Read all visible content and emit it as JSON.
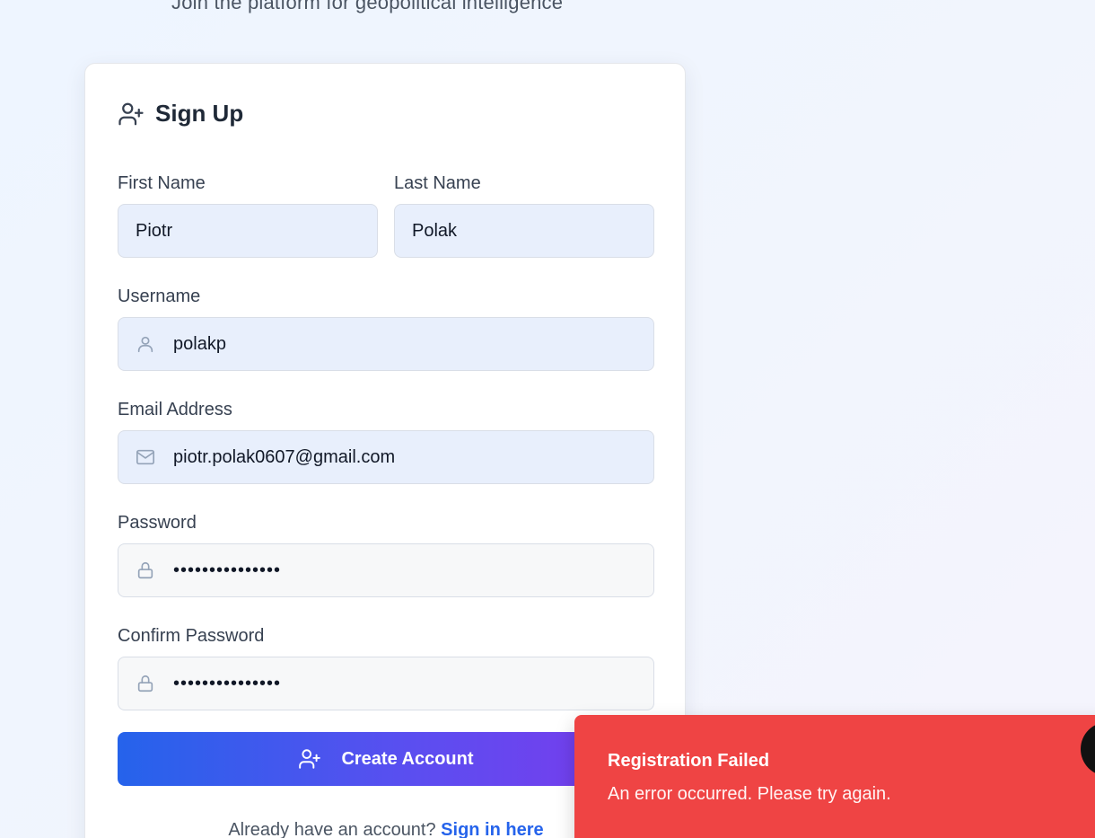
{
  "page": {
    "subtitle": "Join the platform for geopolitical intelligence"
  },
  "signup_card": {
    "icon": "user-plus-icon",
    "title": "Sign Up",
    "first_name": {
      "label": "First Name",
      "value": "Piotr"
    },
    "last_name": {
      "label": "Last Name",
      "value": "Polak"
    },
    "username": {
      "label": "Username",
      "value": "polakp",
      "icon": "user-icon"
    },
    "email": {
      "label": "Email Address",
      "value": "piotr.polak0607@gmail.com",
      "icon": "mail-icon"
    },
    "password": {
      "label": "Password",
      "masked_value": "•••••••••••••••",
      "icon": "lock-icon"
    },
    "confirm_password": {
      "label": "Confirm Password",
      "masked_value": "•••••••••••••••",
      "icon": "lock-icon"
    },
    "submit": {
      "label": "Create Account",
      "icon": "user-plus-icon"
    },
    "signin_prompt": "Already have an account?",
    "signin_link": "Sign in here"
  },
  "toast": {
    "title": "Registration Failed",
    "message": "An error occurred. Please try again.",
    "background": "#ef4444"
  },
  "colors": {
    "accent": "#2563eb",
    "accent_end": "#7c3aed",
    "filled_input": "#e8effc"
  }
}
